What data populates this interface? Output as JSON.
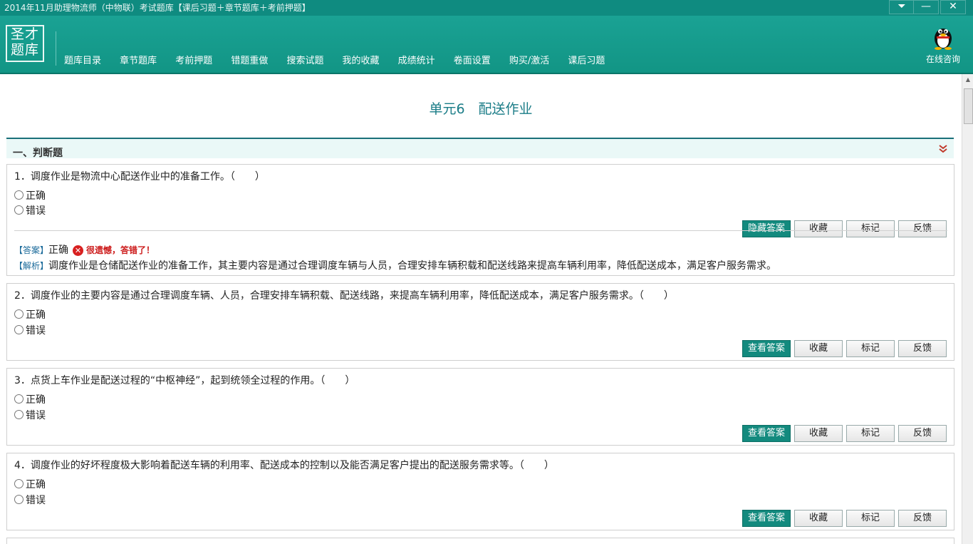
{
  "window": {
    "title": "2014年11月助理物流师（中物联）考试题库【课后习题＋章节题库＋考前押题】",
    "menu_glyph": "⏷",
    "min_glyph": "—",
    "close_glyph": "✕"
  },
  "header": {
    "logo_line1": "圣才",
    "logo_line2": "题库",
    "nav": [
      "题库目录",
      "章节题库",
      "考前押题",
      "错题重做",
      "搜索试题",
      "我的收藏",
      "成绩统计",
      "卷面设置",
      "购买/激活",
      "课后习题"
    ],
    "online_consult": "在线咨询"
  },
  "unit_title": "单元6　配送作业",
  "section_title": "一、判断题",
  "buttons": {
    "hide_answer": "隐藏答案",
    "view_answer": "查看答案",
    "favorite": "收藏",
    "mark": "标记",
    "feedback": "反馈"
  },
  "questions": [
    {
      "text": "1．调度作业是物流中心配送作业中的准备工作。（　　）",
      "options": [
        "正确",
        "错误"
      ],
      "answer_label": "【答案】",
      "answer_value": "正确",
      "wrong_text": "很遗憾，答错了！",
      "analysis_label": "【解析】",
      "analysis_text": "调度作业是仓储配送作业的准备工作，其主要内容是通过合理调度车辆与人员，合理安排车辆积载和配送线路来提高车辆利用率，降低配送成本，满足客户服务需求。"
    },
    {
      "text": "2．调度作业的主要内容是通过合理调度车辆、人员，合理安排车辆积载、配送线路，来提高车辆利用率，降低配送成本，满足客户服务需求。（　　）",
      "options": [
        "正确",
        "错误"
      ]
    },
    {
      "text": "3．点货上车作业是配送过程的“中枢神经”，起到统领全过程的作用。（　　）",
      "options": [
        "正确",
        "错误"
      ]
    },
    {
      "text": "4．调度作业的好坏程度极大影响着配送车辆的利用率、配送成本的控制以及能否满足客户提出的配送服务需求等。（　　）",
      "options": [
        "正确",
        "错误"
      ]
    }
  ],
  "colors": {
    "header_bg": "#129585",
    "primary_button": "#138a7e",
    "title_text": "#1a7c87",
    "error": "#d82020"
  }
}
